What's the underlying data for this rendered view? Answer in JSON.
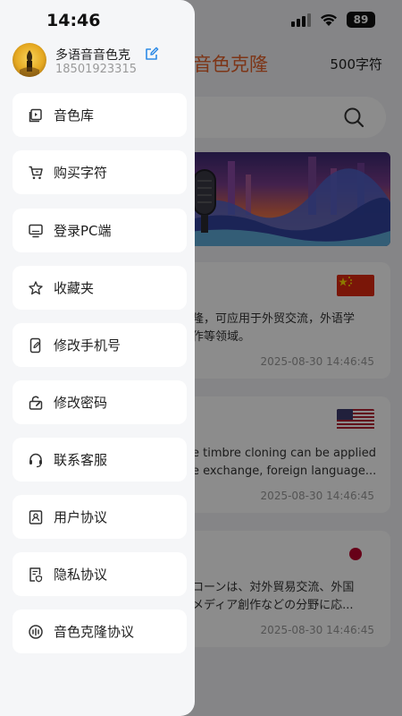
{
  "status_bar": {
    "time": "14:46",
    "battery": "89"
  },
  "header": {
    "title": "音色克隆",
    "char_count": "500字符"
  },
  "user": {
    "name": "多语音音色克",
    "phone": "18501923315"
  },
  "menu": [
    {
      "label": "音色库",
      "icon": "voice-library-icon"
    },
    {
      "label": "购买字符",
      "icon": "cart-icon"
    },
    {
      "label": "登录PC端",
      "icon": "monitor-icon"
    },
    {
      "label": "收藏夹",
      "icon": "star-icon"
    },
    {
      "label": "修改手机号",
      "icon": "phone-edit-icon"
    },
    {
      "label": "修改密码",
      "icon": "lock-edit-icon"
    },
    {
      "label": "联系客服",
      "icon": "headset-icon"
    },
    {
      "label": "用户协议",
      "icon": "user-doc-icon"
    },
    {
      "label": "隐私协议",
      "icon": "privacy-doc-icon"
    },
    {
      "label": "音色克隆协议",
      "icon": "voice-clone-icon"
    }
  ],
  "cards": [
    {
      "language": "chinese",
      "flag": "china-flag",
      "line1": "隆，可应用于外贸交流，外语学",
      "line2": "作等领域。",
      "date": "2025-08-30 14:46:45"
    },
    {
      "language": "english",
      "flag": "usa-flag",
      "line1": "e timbre cloning can be applied",
      "line2": "e exchange, foreign language...",
      "date": "2025-08-30 14:46:45"
    },
    {
      "language": "japanese",
      "flag": "japan-flag",
      "line1": "ローンは、対外貿易交流、外国",
      "line2": "メディア創作などの分野に応...",
      "date": "2025-08-30 14:46:45"
    }
  ],
  "colors": {
    "accent": "#e4622a",
    "edit": "#2e8be6",
    "drawer_bg": "#f5f6f8"
  }
}
